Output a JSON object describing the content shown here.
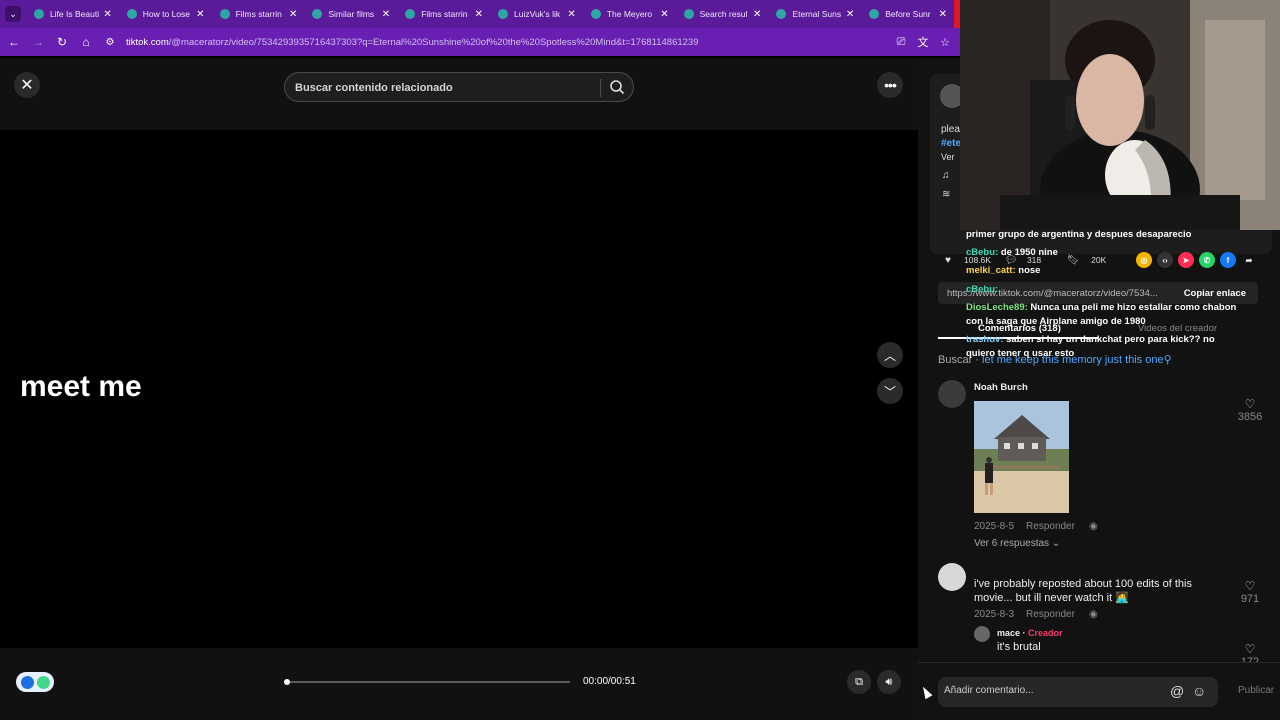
{
  "browser": {
    "tabs": [
      {
        "title": "Life Is Beauti"
      },
      {
        "title": "How to Lose"
      },
      {
        "title": "Films starrin"
      },
      {
        "title": "Similar films"
      },
      {
        "title": "Films starrin"
      },
      {
        "title": "LuizVuk's lik"
      },
      {
        "title": "The Meyero"
      },
      {
        "title": "Search resul"
      },
      {
        "title": "Eternal Suns"
      },
      {
        "title": "Before Sunr"
      }
    ],
    "url_host": "tiktok.com",
    "url_path": "/@maceratorz/video/7534293935716437303?q=Eternal%20Sunshine%20of%20the%20Spotless%20Mind&t=1768114861239"
  },
  "player": {
    "search_placeholder": "Buscar contenido relacionado",
    "caption": "meet me",
    "time": "00:00/00:51",
    "progress_fraction": 0.0
  },
  "panel": {
    "frag_desc": "plea",
    "frag_tag": "#ete",
    "frag_more": "Ver",
    "stats": {
      "likes": "108.6K",
      "comments": "318",
      "saves": "20K"
    },
    "link_url": "https://www.tiktok.com/@maceratorz/video/7534...",
    "link_copy": "Copiar enlace",
    "tab_comments": "Comentarios (318)",
    "tab_creator": "Videos del creador",
    "related_label": "Buscar · ",
    "related_query": "let me keep this memory just this one"
  },
  "chat": [
    {
      "user": "",
      "text": "primer grupo de argentina y despues desaparecio"
    },
    {
      "user": "cBebu:",
      "text": " de 1950 nine"
    },
    {
      "user": "melki_catt:",
      "text": " nose"
    },
    {
      "user": "cBebu:",
      "text": ""
    },
    {
      "user": "DiosLeche89:",
      "text": " Nunca una peli me hizo estallar como chabon"
    },
    {
      "user": "",
      "text": "con la saga que Airplane amigo de 1980"
    },
    {
      "user": "trashuv:",
      "text": " saben si hay un dankchat pero para kick?? no"
    },
    {
      "user": "",
      "text": "quiero tener q usar esto"
    }
  ],
  "comments": [
    {
      "name": "Noah Burch",
      "date": "2025-8-5",
      "reply": "Responder",
      "likes": "3856",
      "replies": "Ver 6 respuestas"
    },
    {
      "name": "ㅤ ㅤㅤ ㅤㅤ ㅤㅤ  ㅤㅤ ㅤㅤ",
      "text": "i've probably reposted about 100 edits of this movie... but ill never watch it 🧑‍💻",
      "date": "2025-8-3",
      "reply": "Responder",
      "likes": "971"
    },
    {
      "name": "mace",
      "creator": "Creador",
      "text": "it's brutal",
      "likes": "172"
    }
  ],
  "composer": {
    "placeholder": "Añadir comentario...",
    "publish": "Publicar"
  },
  "colors": {
    "tab_strip": "#5b1a9a",
    "address_bar": "#6a1fb3",
    "creator": "#ff3b6a",
    "link": "#4fa8ff"
  }
}
